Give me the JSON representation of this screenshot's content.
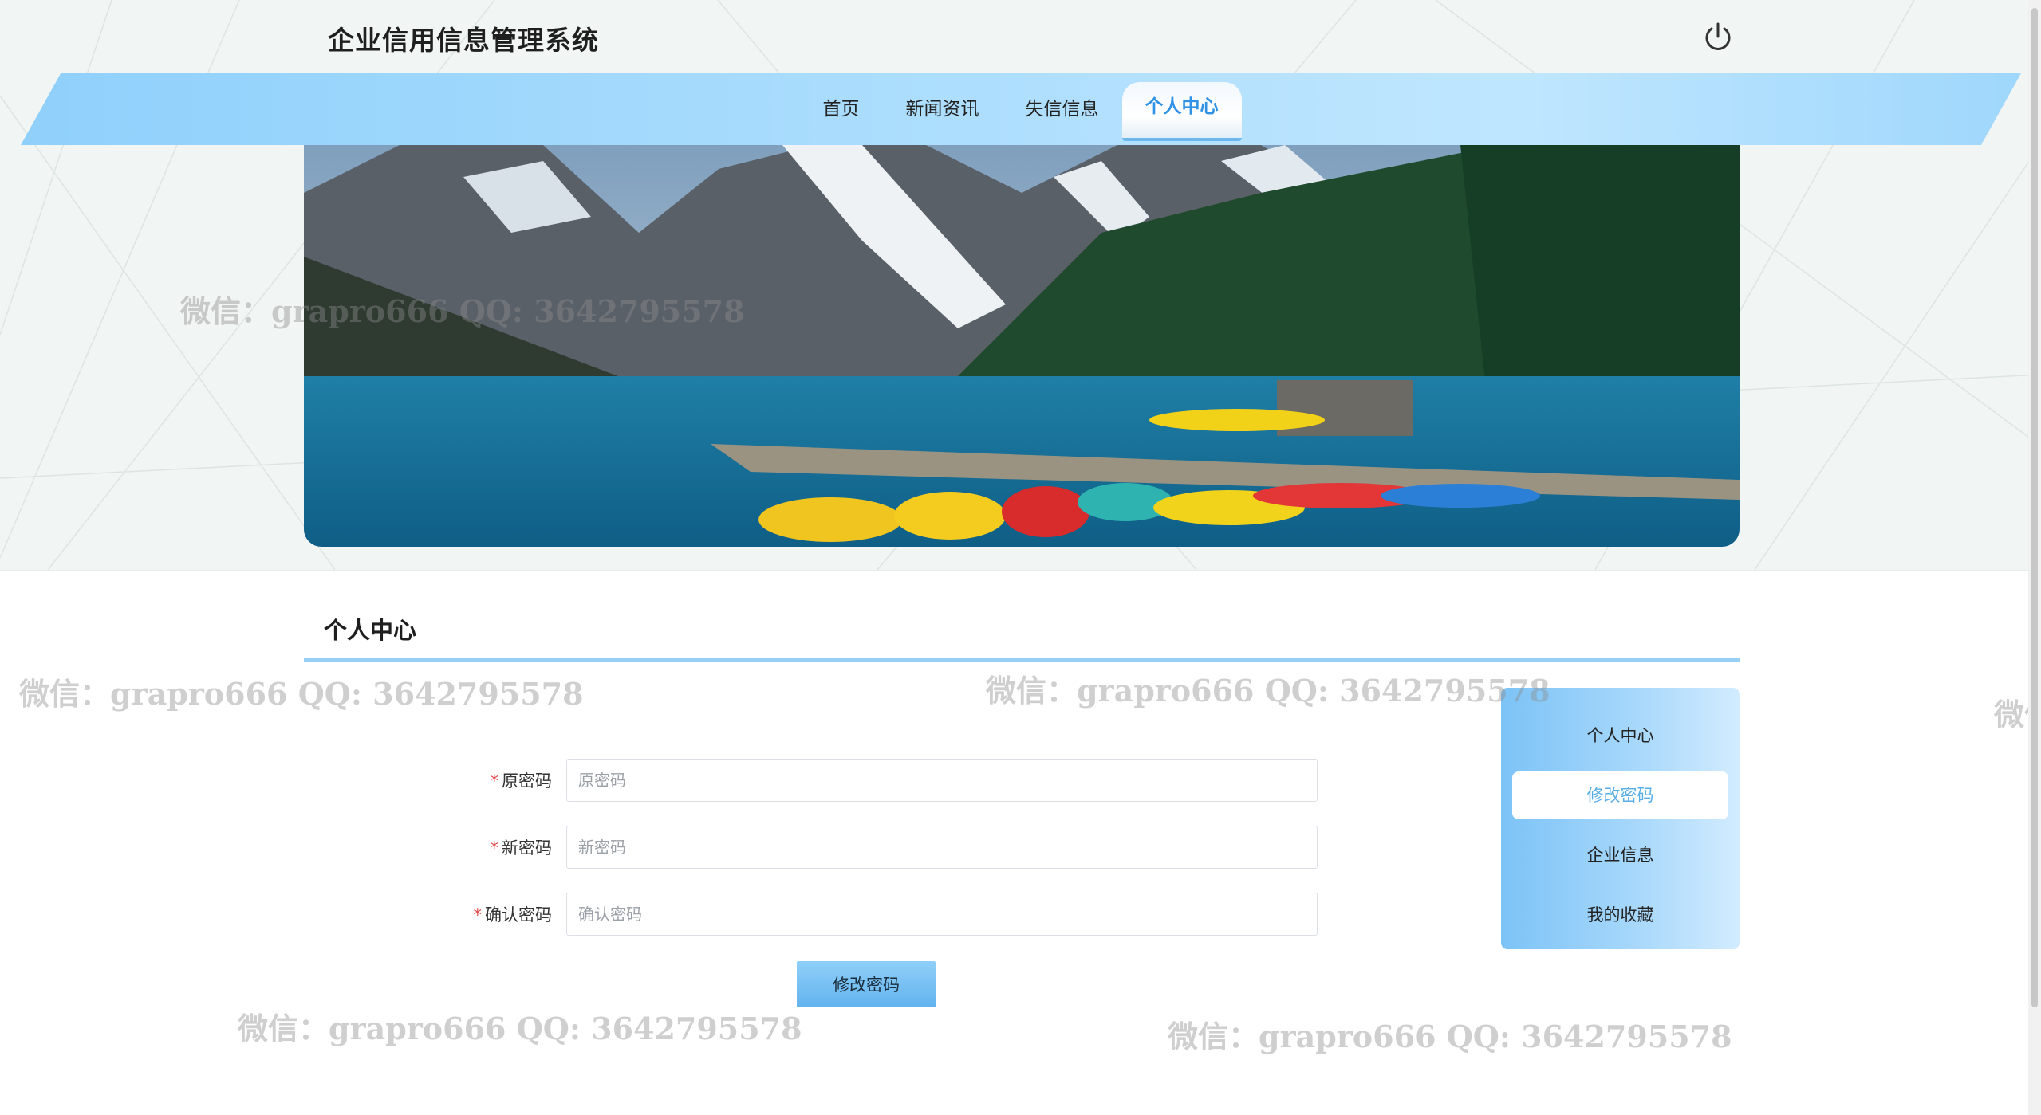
{
  "app": {
    "title": "企业信用信息管理系统"
  },
  "header": {
    "power_icon": "power-icon"
  },
  "nav": {
    "items": [
      {
        "label": "首页"
      },
      {
        "label": "新闻资讯"
      },
      {
        "label": "失信信息"
      },
      {
        "label": "个人中心",
        "active": true
      }
    ]
  },
  "banner": {
    "alt": "mountain-lake-with-canoes"
  },
  "section": {
    "title": "个人中心"
  },
  "form": {
    "fields": [
      {
        "label": "原密码",
        "placeholder": "原密码",
        "value": ""
      },
      {
        "label": "新密码",
        "placeholder": "新密码",
        "value": ""
      },
      {
        "label": "确认密码",
        "placeholder": "确认密码",
        "value": ""
      }
    ],
    "submit_label": "修改密码"
  },
  "side_menu": {
    "items": [
      {
        "label": "个人中心"
      },
      {
        "label": "修改密码",
        "active": true
      },
      {
        "label": "企业信息"
      },
      {
        "label": "我的收藏"
      }
    ]
  },
  "watermark": {
    "text": "微信：grapro666 QQ: 3642795578"
  },
  "colors": {
    "accent": "#2f92e6",
    "nav_band": "#a9dcfd",
    "required": "#e24b4b"
  }
}
